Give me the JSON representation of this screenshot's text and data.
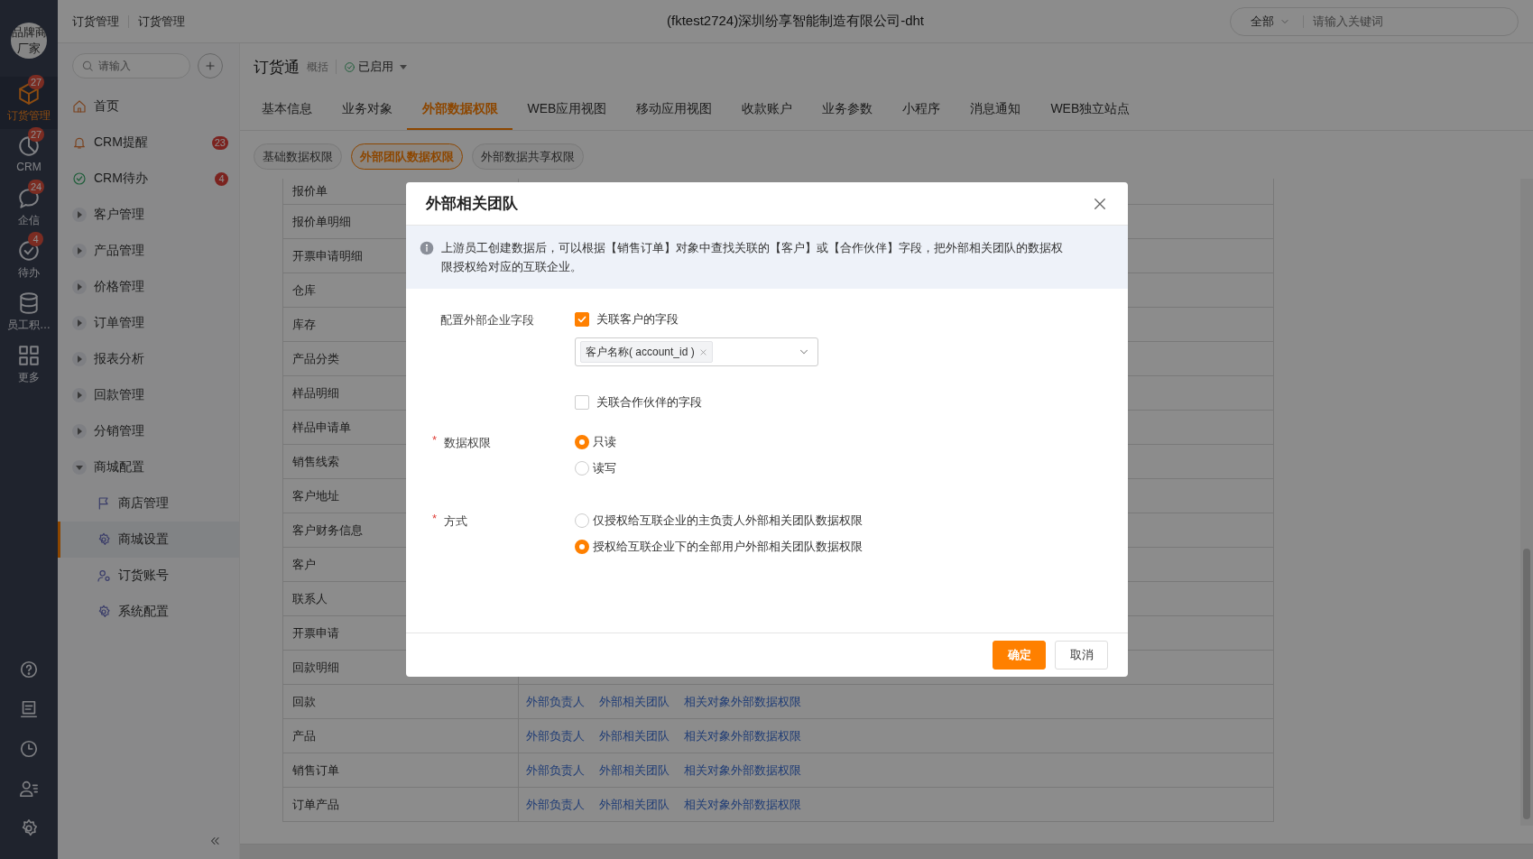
{
  "rail": {
    "logo": "品牌商厂家",
    "items": [
      {
        "label": "订货管理",
        "badge": "27",
        "selected": true
      },
      {
        "label": "CRM",
        "badge": "27",
        "selected": false
      },
      {
        "label": "企信",
        "badge": "24",
        "selected": false
      },
      {
        "label": "待办",
        "badge": "4",
        "selected": false
      },
      {
        "label": "员工积…",
        "selected": false
      },
      {
        "label": "更多",
        "selected": false
      }
    ]
  },
  "breadcrumbs": [
    "订货管理",
    "订货管理"
  ],
  "header_title": "(fktest2724)深圳纷享智能制造有限公司-dht",
  "global_search": {
    "scope": "全部",
    "placeholder": "请输入关键词"
  },
  "sidebar": {
    "search": {
      "placeholder": "请输入"
    },
    "items": [
      {
        "label": "首页",
        "kind": "link"
      },
      {
        "label": "CRM提醒",
        "kind": "link",
        "badge": "23"
      },
      {
        "label": "CRM待办",
        "kind": "link",
        "badge": "4"
      },
      {
        "label": "客户管理",
        "kind": "group",
        "expanded": false
      },
      {
        "label": "产品管理",
        "kind": "group",
        "expanded": false
      },
      {
        "label": "价格管理",
        "kind": "group",
        "expanded": false
      },
      {
        "label": "订单管理",
        "kind": "group",
        "expanded": false
      },
      {
        "label": "报表分析",
        "kind": "group",
        "expanded": false
      },
      {
        "label": "回款管理",
        "kind": "group",
        "expanded": false
      },
      {
        "label": "分销管理",
        "kind": "group",
        "expanded": false
      },
      {
        "label": "商城配置",
        "kind": "group",
        "expanded": true,
        "children": [
          {
            "label": "商店管理",
            "selected": false
          },
          {
            "label": "商城设置",
            "selected": true
          },
          {
            "label": "订货账号",
            "selected": false
          },
          {
            "label": "系统配置",
            "selected": false
          }
        ]
      }
    ]
  },
  "app": {
    "name": "订货通",
    "summary": "概括",
    "status": "已启用"
  },
  "tabs": [
    {
      "label": "基本信息",
      "selected": false
    },
    {
      "label": "业务对象",
      "selected": false
    },
    {
      "label": "外部数据权限",
      "selected": true
    },
    {
      "label": "WEB应用视图",
      "selected": false
    },
    {
      "label": "移动应用视图",
      "selected": false
    },
    {
      "label": "收款账户",
      "selected": false
    },
    {
      "label": "业务参数",
      "selected": false
    },
    {
      "label": "小程序",
      "selected": false
    },
    {
      "label": "消息通知",
      "selected": false
    },
    {
      "label": "WEB独立站点",
      "selected": false
    }
  ],
  "subtabs": [
    {
      "label": "基础数据权限",
      "selected": false
    },
    {
      "label": "外部团队数据权限",
      "selected": true
    },
    {
      "label": "外部数据共享权限",
      "selected": false
    }
  ],
  "table": {
    "rows": [
      {
        "object": "报价单"
      },
      {
        "object": "报价单明细"
      },
      {
        "object": "开票申请明细"
      },
      {
        "object": "仓库"
      },
      {
        "object": "库存"
      },
      {
        "object": "产品分类"
      },
      {
        "object": "样品明细"
      },
      {
        "object": "样品申请单"
      },
      {
        "object": "销售线索"
      },
      {
        "object": "客户地址"
      },
      {
        "object": "客户财务信息"
      },
      {
        "object": "客户"
      },
      {
        "object": "联系人"
      },
      {
        "object": "开票申请"
      },
      {
        "object": "回款明细"
      },
      {
        "object": "回款",
        "links": [
          "外部负责人",
          "外部相关团队",
          "相关对象外部数据权限"
        ]
      },
      {
        "object": "产品",
        "links": [
          "外部负责人",
          "外部相关团队",
          "相关对象外部数据权限"
        ]
      },
      {
        "object": "销售订单",
        "links": [
          "外部负责人",
          "外部相关团队",
          "相关对象外部数据权限"
        ]
      },
      {
        "object": "订单产品",
        "links": [
          "外部负责人",
          "外部相关团队",
          "相关对象外部数据权限"
        ]
      }
    ]
  },
  "dialog": {
    "title": "外部相关团队",
    "info": "上游员工创建数据后，可以根据【销售订单】对象中查找关联的【客户】或【合作伙伴】字段，把外部相关团队的数据权限授权给对应的互联企业。",
    "fields": [
      {
        "label": "配置外部企业字段",
        "kind": "checkbox",
        "options": [
          {
            "label": "关联客户的字段",
            "checked": true,
            "tags": [
              "客户名称( account_id )"
            ]
          },
          {
            "label": "关联合作伙伴的字段",
            "checked": false
          }
        ]
      },
      {
        "label": "数据权限",
        "required_mark": "*",
        "kind": "radio",
        "options": [
          {
            "label": "只读",
            "selected": true
          },
          {
            "label": "读写",
            "selected": false
          }
        ]
      },
      {
        "label": "方式",
        "required_mark": "*",
        "kind": "radio",
        "options": [
          {
            "label": "仅授权给互联企业的主负责人外部相关团队数据权限",
            "selected": false
          },
          {
            "label": "授权给互联企业下的全部用户外部相关团队数据权限",
            "selected": true
          }
        ]
      }
    ],
    "buttons": [
      {
        "label": "确定",
        "kind": "primary"
      },
      {
        "label": "取消",
        "kind": "default"
      }
    ]
  }
}
